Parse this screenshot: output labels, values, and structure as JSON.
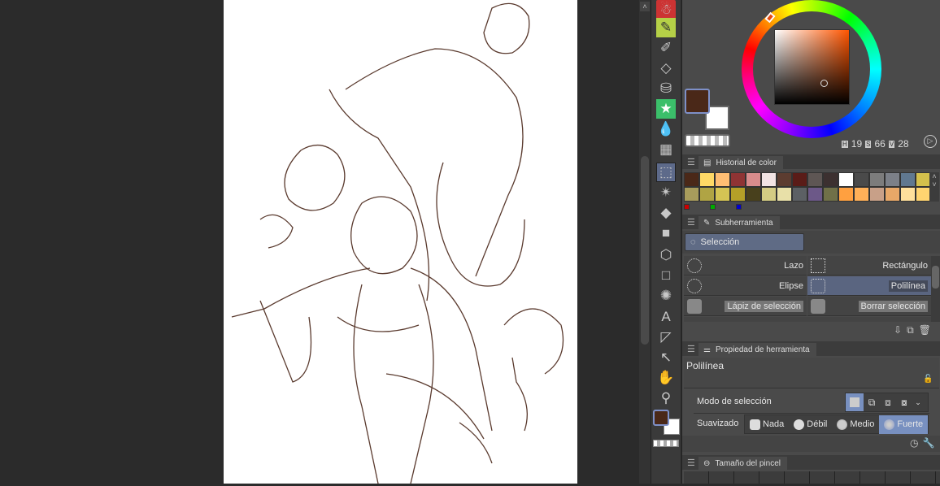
{
  "color": {
    "main": "#4a2818",
    "sub": "#ffffff",
    "hsv": {
      "h_label": "H",
      "h": "19",
      "s_label": "S",
      "s": "66",
      "v_label": "V",
      "v": "28"
    }
  },
  "history": {
    "title": "Historial de color",
    "swatches": [
      "#4a2818",
      "#ffd966",
      "#ffbe73",
      "#8f3434",
      "#d98c8c",
      "#f2e4e4",
      "#5c3c30",
      "#5a1c18",
      "#5e5654",
      "#3c3030",
      "#ffffff",
      "#4a4a4a",
      "#7c7c7c",
      "#7c8088",
      "#607890",
      "#d4c04c",
      "#a89c5c",
      "#b0a444",
      "#d4c454",
      "#b4a028",
      "#48401c",
      "#d4cc84",
      "#e8e0a8",
      "#5c6064",
      "#6c5888",
      "#707048",
      "#ffa040",
      "#ffb058",
      "#c8a088",
      "#e8a868",
      "#ffe09c",
      "#ffd470"
    ],
    "markers": [
      "#cc0000",
      "#00aa00",
      "#0000cc"
    ]
  },
  "subtool": {
    "title": "Subherramienta",
    "group": "Selección",
    "items": [
      "Lazo",
      "Rectángulo",
      "Elipse",
      "Polilínea",
      "Lápiz de selección",
      "Borrar selección"
    ]
  },
  "property": {
    "title": "Propiedad de herramienta",
    "tool_name": "Polilínea",
    "mode_label": "Modo de selección",
    "smooth_label": "Suavizado",
    "smooth_options": [
      "Nada",
      "Débil",
      "Medio",
      "Fuerte"
    ]
  },
  "brush_size": {
    "title": "Tamaño del pincel"
  }
}
